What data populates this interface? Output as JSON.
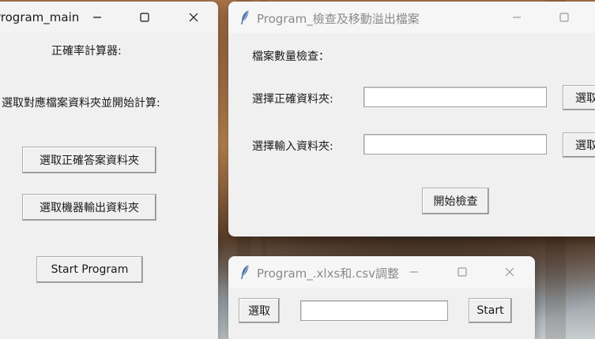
{
  "main_window": {
    "title": "Program_main",
    "heading": "正確率計算器:",
    "instruction": "選取對應檔案資料夾並開始計算:",
    "btn_select_answer": "選取正確答案資料夾",
    "btn_select_output": "選取機器輸出資料夾",
    "btn_start": "Start Program"
  },
  "check_window": {
    "title": "Program_檢查及移動溢出檔案",
    "heading": "檔案數量檢查：",
    "label_correct": "選擇正確資料夾:",
    "label_input": "選擇輸入資料夾:",
    "input_correct_value": "",
    "input_input_value": "",
    "btn_browse_correct": "選取",
    "btn_browse_input": "選取",
    "btn_start_check": "開始檢查"
  },
  "xlsx_window": {
    "title": "Program_.xlxs和.csv調整",
    "btn_select": "選取",
    "path_value": "",
    "btn_start": "Start"
  },
  "icons": {
    "app_icon": "feather-icon",
    "minimize": "minimize-icon",
    "maximize": "maximize-icon",
    "close": "close-icon"
  }
}
